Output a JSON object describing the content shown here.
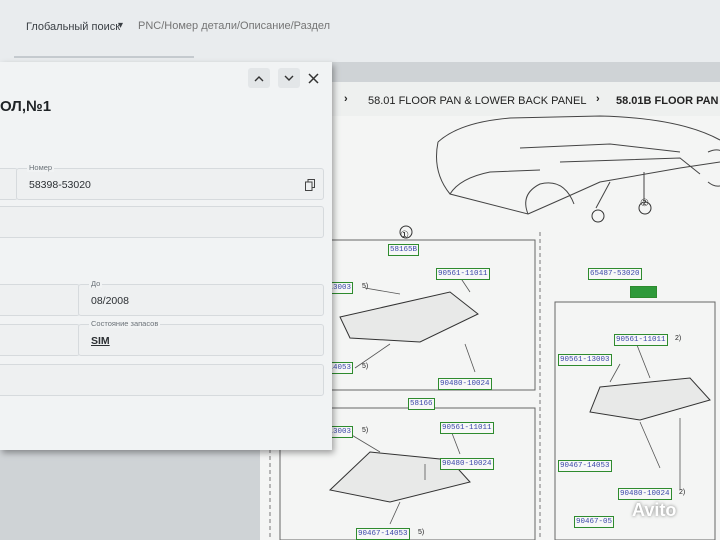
{
  "search": {
    "scope_label": "Глобальный поиск",
    "placeholder": "PNC/Номер детали/Описание/Раздел"
  },
  "breadcrumb": {
    "items": [
      "58.01 FLOOR PAN & LOWER BACK PANEL",
      "58.01B FLOOR PAN"
    ]
  },
  "diagram": {
    "callouts": [
      "①",
      "②"
    ],
    "groups": [
      {
        "name": "58165B",
        "parts": [
          {
            "num": "-13003",
            "qty": "5)"
          },
          {
            "num": "90561-11011",
            "qty": ""
          },
          {
            "num": "-14053",
            "qty": "5)"
          },
          {
            "num": "90480-10024",
            "qty": ""
          }
        ]
      },
      {
        "name": "58166",
        "parts": [
          {
            "num": "-13003",
            "qty": "5)"
          },
          {
            "num": "90561-11011",
            "qty": ""
          },
          {
            "num": "90480-10024",
            "qty": ""
          },
          {
            "num": "90467-14053",
            "qty": "5)"
          }
        ]
      },
      {
        "name": "",
        "parts": [
          {
            "num": "65487-53020",
            "qty": ""
          },
          {
            "num": "90561-11011",
            "qty": "2)"
          },
          {
            "num": "90561-13003",
            "qty": ""
          },
          {
            "num": "90467-14053",
            "qty": ""
          },
          {
            "num": "90480-10024",
            "qty": "2)"
          },
          {
            "num": "90467-05",
            "qty": ""
          }
        ]
      }
    ]
  },
  "dialog": {
    "title": "ОЛ,№1",
    "number_label": "Номер",
    "number_value": "58398-53020",
    "to_label": "До",
    "to_value": "08/2008",
    "stock_label": "Состояние запасов",
    "stock_value": "SIM",
    "icons": [
      "chevron-up-icon",
      "chevron-down-icon",
      "close-icon",
      "copy-icon"
    ]
  },
  "watermark": "Avito",
  "colors": {
    "tag_border": "#2e8b2e",
    "tag_text": "#3a46a8",
    "dialog_bg": "#f1f3f4"
  }
}
